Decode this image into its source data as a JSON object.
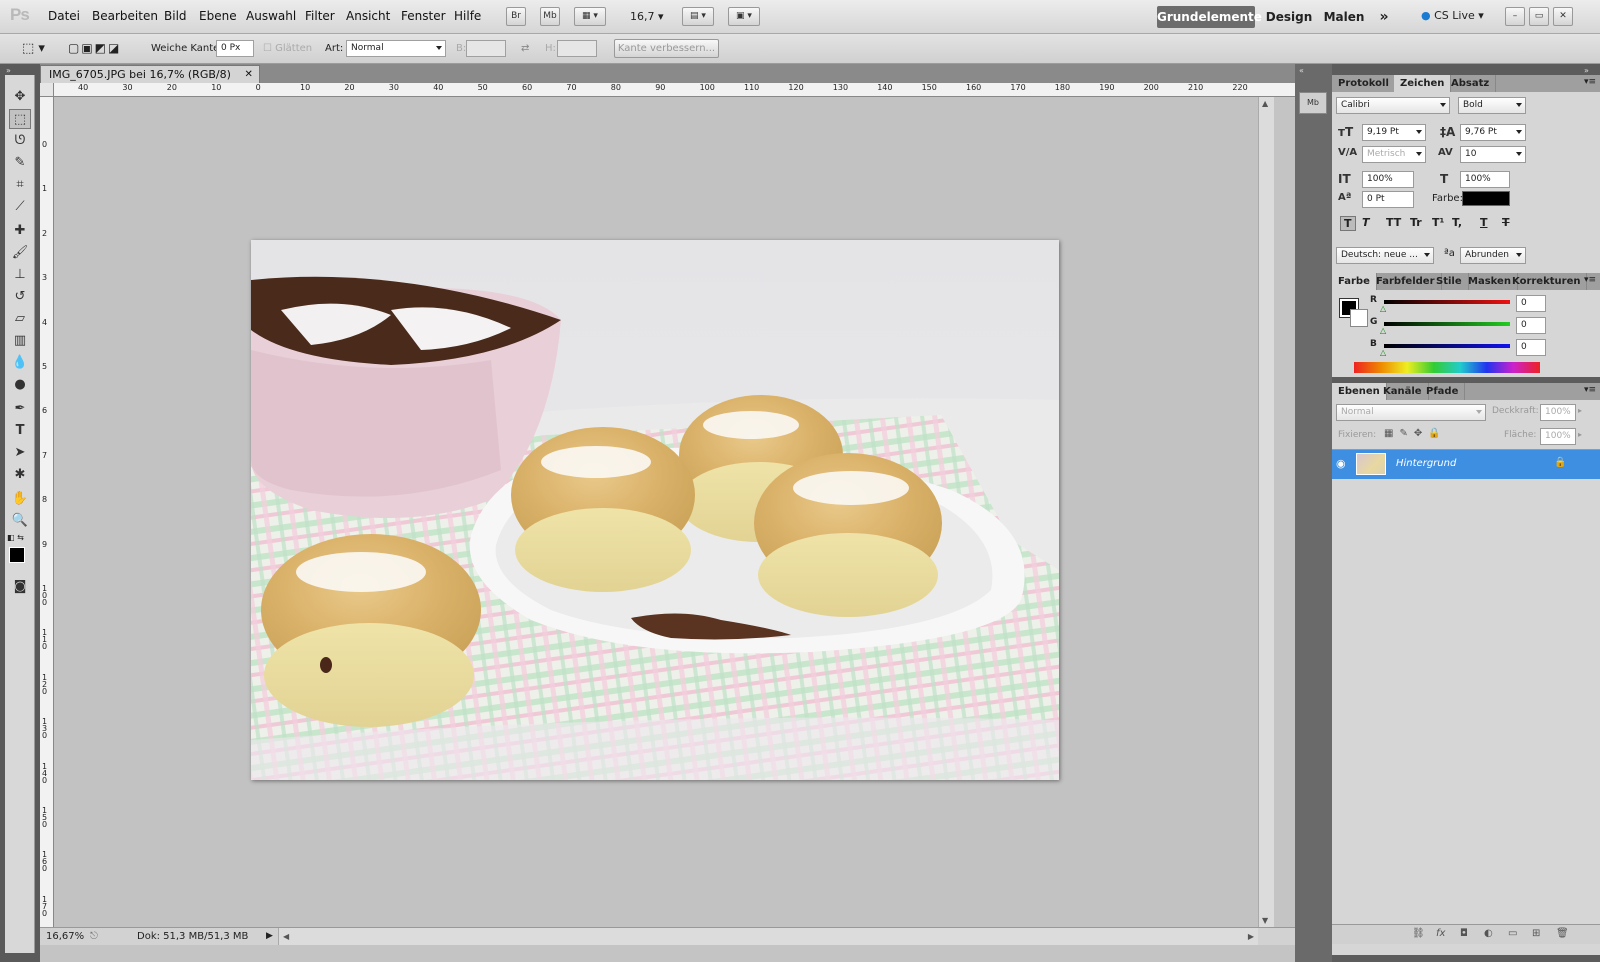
{
  "app": {
    "logo": "Ps",
    "accent": "#3e8ee2"
  },
  "menu": [
    "Datei",
    "Bearbeiten",
    "Bild",
    "Ebene",
    "Auswahl",
    "Filter",
    "Ansicht",
    "Fenster",
    "Hilfe"
  ],
  "appbar": {
    "br": "Br",
    "mb": "Mb",
    "zoom": "16,7"
  },
  "workspaces": {
    "active": "Grundelemente",
    "design": "Design",
    "malen": "Malen",
    "more": "»",
    "cslive": "CS Live"
  },
  "options": {
    "feather_label": "Weiche Kante:",
    "feather_value": "0 Px",
    "antialias": "Glätten",
    "style_label": "Art:",
    "style_value": "Normal",
    "width_label": "B:",
    "height_label": "H:",
    "refine": "Kante verbessern..."
  },
  "document": {
    "tab": "IMG_6705.JPG bei 16,7% (RGB/8)",
    "zoom_status": "16,67%",
    "doc_status": "Dok: 51,3 MB/51,3 MB"
  },
  "ruler": {
    "top": [
      "40",
      "30",
      "20",
      "10",
      "0",
      "10",
      "20",
      "30",
      "40",
      "50",
      "60",
      "70",
      "80",
      "90",
      "100",
      "110",
      "120",
      "130",
      "140",
      "150",
      "160",
      "170",
      "180",
      "190",
      "200",
      "210",
      "220"
    ],
    "left": [
      "0",
      "1",
      "2",
      "3",
      "4",
      "5",
      "6",
      "7",
      "8",
      "9",
      "100",
      "110",
      "120",
      "130",
      "140",
      "150",
      "160",
      "170"
    ]
  },
  "char_panel": {
    "tabs": [
      "Protokoll",
      "Zeichen",
      "Absatz"
    ],
    "font": "Calibri",
    "style": "Bold",
    "size": "9,19 Pt",
    "leading": "9,76 Pt",
    "kerning": "Metrisch",
    "tracking": "10",
    "vscale": "100%",
    "hscale": "100%",
    "baseline": "0 Pt",
    "color_label": "Farbe:",
    "language": "Deutsch: neue ...",
    "aa_label": "a",
    "aa": "Abrunden",
    "styles": [
      "T",
      "T",
      "TT",
      "Tr",
      "T¹",
      "T,",
      "T",
      "T"
    ]
  },
  "color_panel": {
    "tabs": [
      "Farbe",
      "Farbfelder",
      "Stile",
      "Masken",
      "Korrekturen"
    ],
    "channels": [
      {
        "label": "R",
        "value": "0",
        "color": "#e11"
      },
      {
        "label": "G",
        "value": "0",
        "color": "#2c2"
      },
      {
        "label": "B",
        "value": "0",
        "color": "#11e"
      }
    ]
  },
  "layers_panel": {
    "tabs": [
      "Ebenen",
      "Kanäle",
      "Pfade"
    ],
    "blend": "Normal",
    "opacity_label": "Deckkraft:",
    "opacity": "100%",
    "lock_label": "Fixieren:",
    "fill_label": "Fläche:",
    "fill": "100%",
    "layers": [
      {
        "name": "Hintergrund"
      }
    ]
  }
}
